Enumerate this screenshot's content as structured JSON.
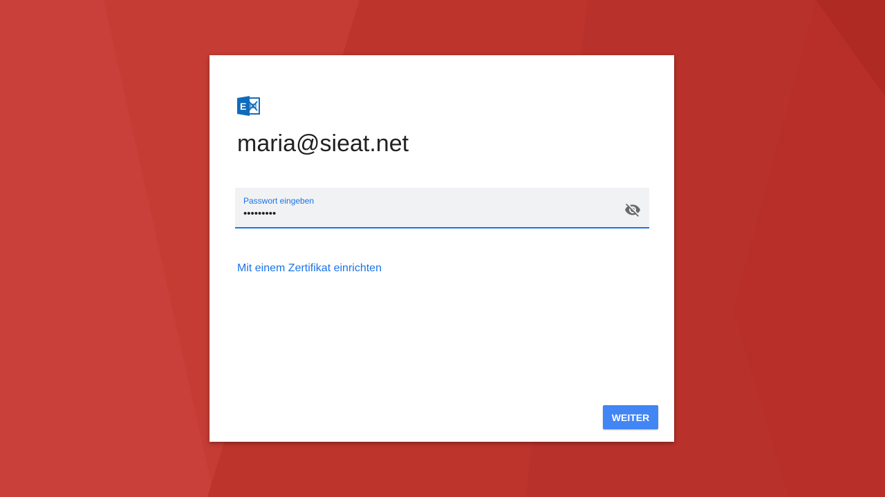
{
  "theme": {
    "background": "#c53a32",
    "accent": "#1a73e8",
    "button": "#4285f4"
  },
  "logo": {
    "icon": "exchange-icon"
  },
  "account": {
    "email": "maria@sieat.net"
  },
  "password": {
    "label": "Passwort eingeben",
    "value": "•••••••••",
    "toggle_icon": "visibility-off-icon"
  },
  "certificate_link": "Mit einem Zertifikat einrichten",
  "next_button": "WEITER"
}
